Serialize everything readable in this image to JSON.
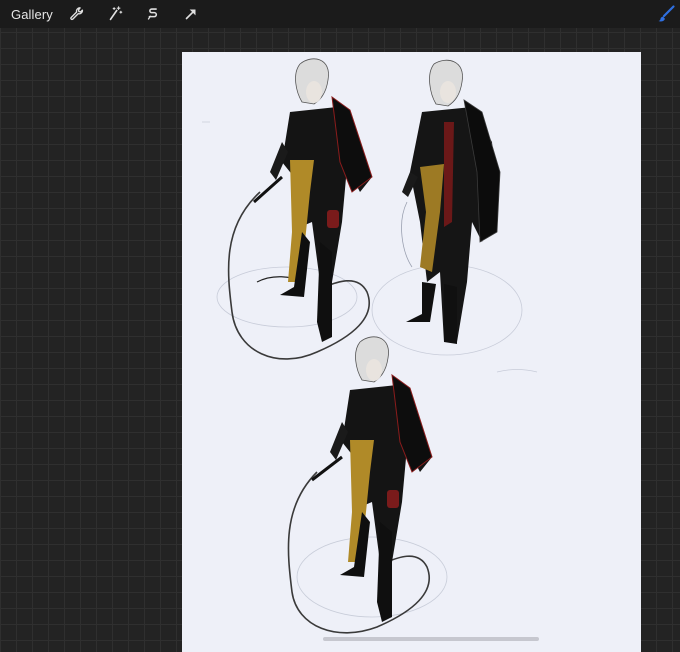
{
  "toolbar": {
    "gallery_label": "Gallery",
    "tools": [
      {
        "name": "wrench-icon",
        "action": "actions"
      },
      {
        "name": "magic-wand-icon",
        "action": "adjustments"
      },
      {
        "name": "selection-icon",
        "action": "selection"
      },
      {
        "name": "transform-arrow-icon",
        "action": "transform"
      }
    ],
    "brush_icon": "brush-icon",
    "accent_color": "#2f6fe0"
  },
  "canvas": {
    "background": "#eef0f8",
    "figures": [
      {
        "name": "character-sketch-1"
      },
      {
        "name": "character-sketch-2"
      },
      {
        "name": "character-sketch-3"
      }
    ]
  }
}
